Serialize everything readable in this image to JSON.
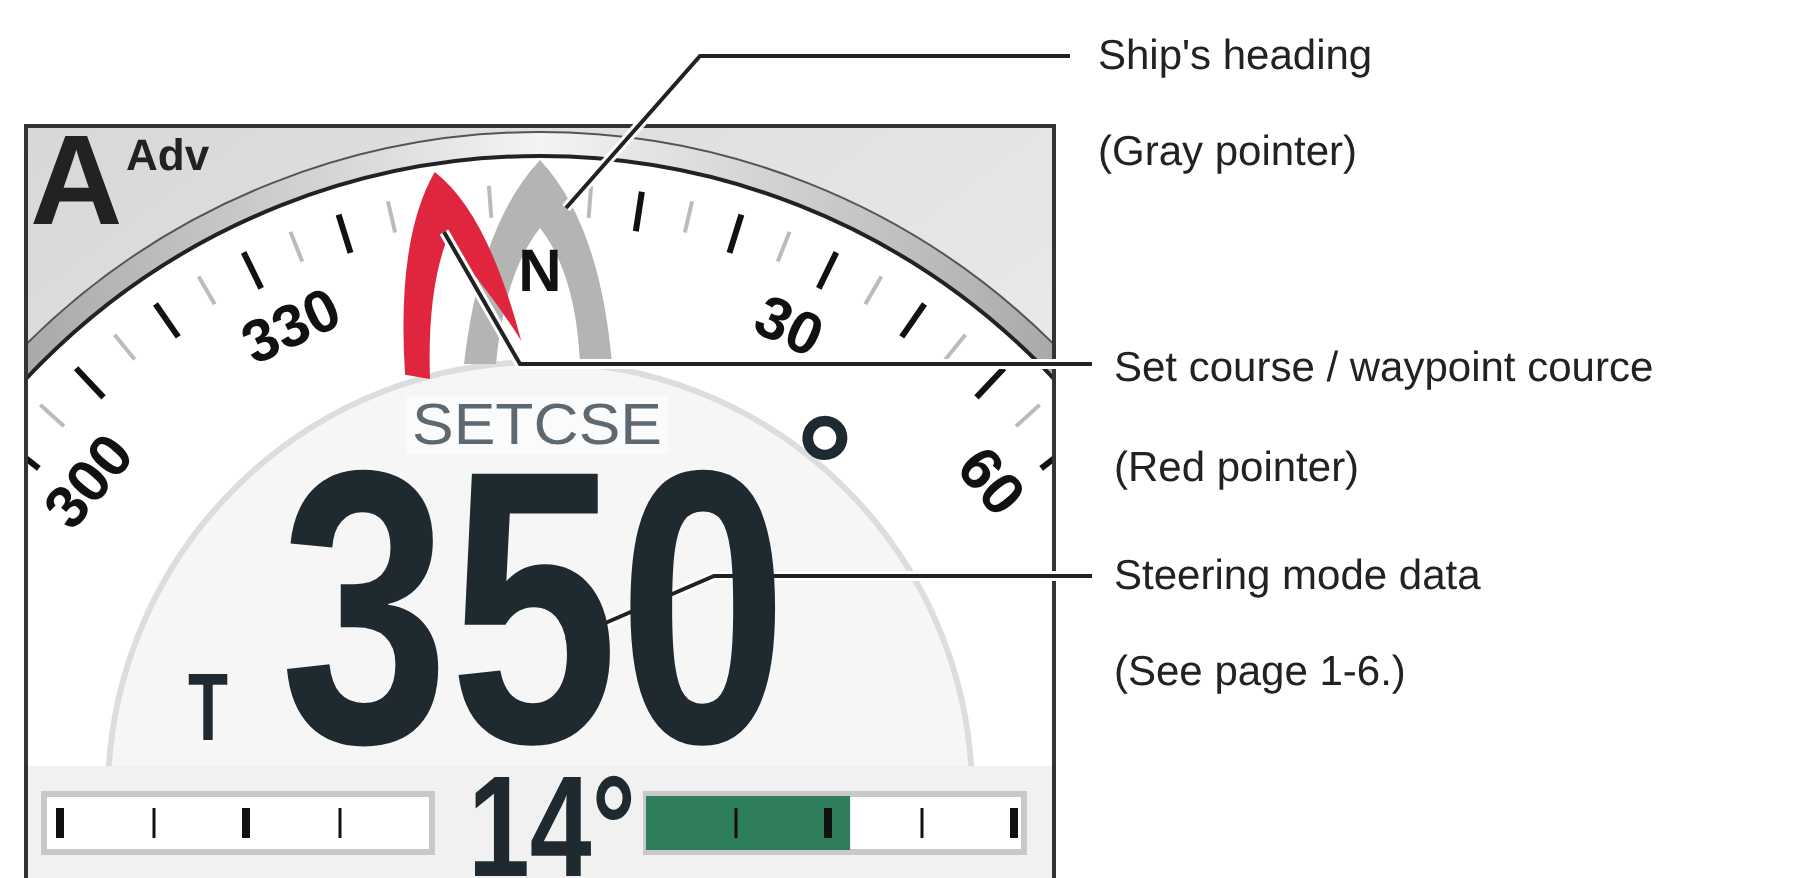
{
  "display": {
    "mode_letter": "A",
    "mode_suffix": "Adv",
    "dial_labels": [
      "300",
      "330",
      "N",
      "30",
      "60"
    ],
    "data_label": "SETCSE",
    "reference": "T",
    "value": "350",
    "degree_mark": "°",
    "rudder": {
      "reading": "14°",
      "starboard": {
        "level": 0.54
      }
    }
  },
  "callouts": [
    {
      "title": "Ship's heading",
      "note": "(Gray pointer)"
    },
    {
      "title": "Set course / waypoint cource",
      "note": "(Red pointer)"
    },
    {
      "title": "Steering mode data",
      "note": "(See page 1-6.)"
    }
  ]
}
